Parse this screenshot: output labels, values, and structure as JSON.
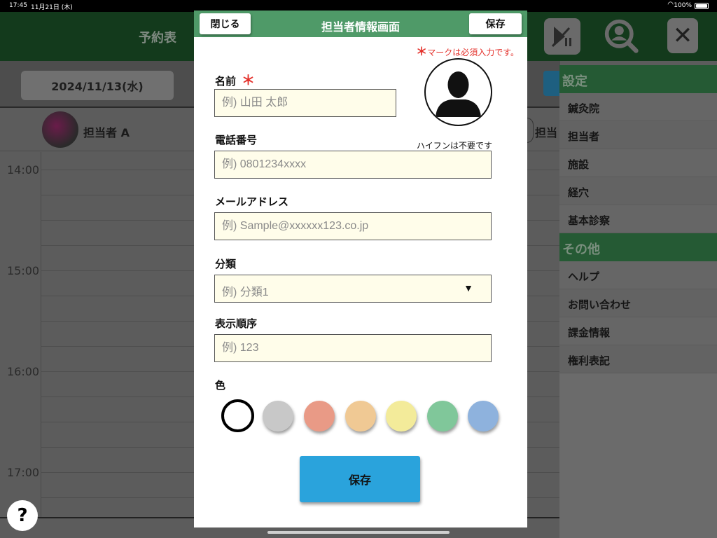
{
  "status_bar": {
    "time": "17:45",
    "date": "11月21日 (木)",
    "battery": "100%"
  },
  "app": {
    "title": "予約表",
    "date_button": "2024/11/13(水)",
    "staff": [
      {
        "name": "担当者 A"
      },
      {
        "name": "担当"
      }
    ],
    "hours": [
      "14:00",
      "15:00",
      "16:00",
      "17:00"
    ],
    "help_label": "?",
    "close_label": "✕"
  },
  "sidebar": {
    "settings_header": "設定",
    "settings_items": [
      "鍼灸院",
      "担当者",
      "施設",
      "経穴",
      "基本診察"
    ],
    "other_header": "その他",
    "other_items": [
      "ヘルプ",
      "お問い合わせ",
      "課金情報",
      "権利表記"
    ]
  },
  "modal": {
    "title": "担当者情報画面",
    "close_label": "閉じる",
    "save_label": "保存",
    "required_note": "マークは必須入力です。",
    "required_mark": "＊",
    "name_label": "名前",
    "name_placeholder": "例) 山田 太郎",
    "phone_label": "電話番号",
    "phone_hint": "ハイフンは不要です",
    "phone_placeholder": "例) 0801234xxxx",
    "email_label": "メールアドレス",
    "email_placeholder": "例) Sample@xxxxxx123.co.jp",
    "category_label": "分類",
    "category_value": "例) 分類1",
    "category_arrow": "▼",
    "order_label": "表示順序",
    "order_placeholder": "例) 123",
    "color_label": "色",
    "colors": [
      "#ffffff",
      "#c8c8c8",
      "#e99a86",
      "#f0c994",
      "#f3eb9a",
      "#80c79a",
      "#8eb2dd"
    ],
    "selected_color_index": 0,
    "bottom_save_label": "保存"
  }
}
